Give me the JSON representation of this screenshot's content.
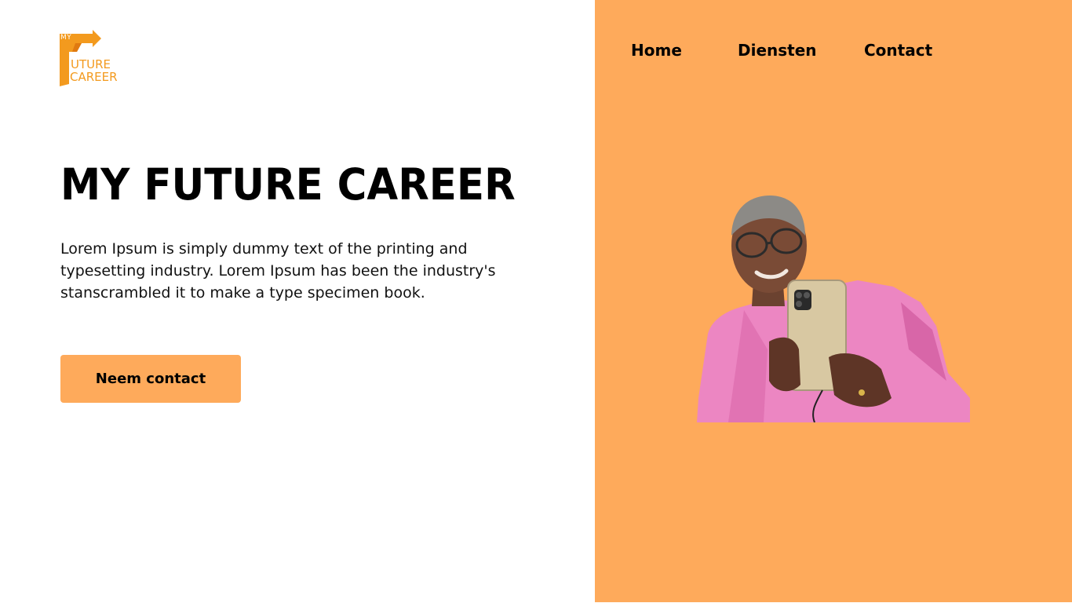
{
  "logo": {
    "my": "MY",
    "future": "UTURE",
    "career": "CAREER",
    "brand_color": "#F39A1E"
  },
  "nav": {
    "items": [
      {
        "label": "Home"
      },
      {
        "label": "Diensten"
      },
      {
        "label": "Contact"
      }
    ]
  },
  "hero": {
    "title": "MY FUTURE CAREER",
    "text": "Lorem Ipsum is simply dummy text of the printing and typesetting industry. Lorem Ipsum has been the industry's stanscrambled it to make a type specimen book.",
    "cta_label": "Neem contact"
  },
  "colors": {
    "accent": "#FEAA5B",
    "text": "#000000",
    "background": "#FFFFFF"
  },
  "photo": {
    "subject": "woman-holding-phone-photo"
  }
}
